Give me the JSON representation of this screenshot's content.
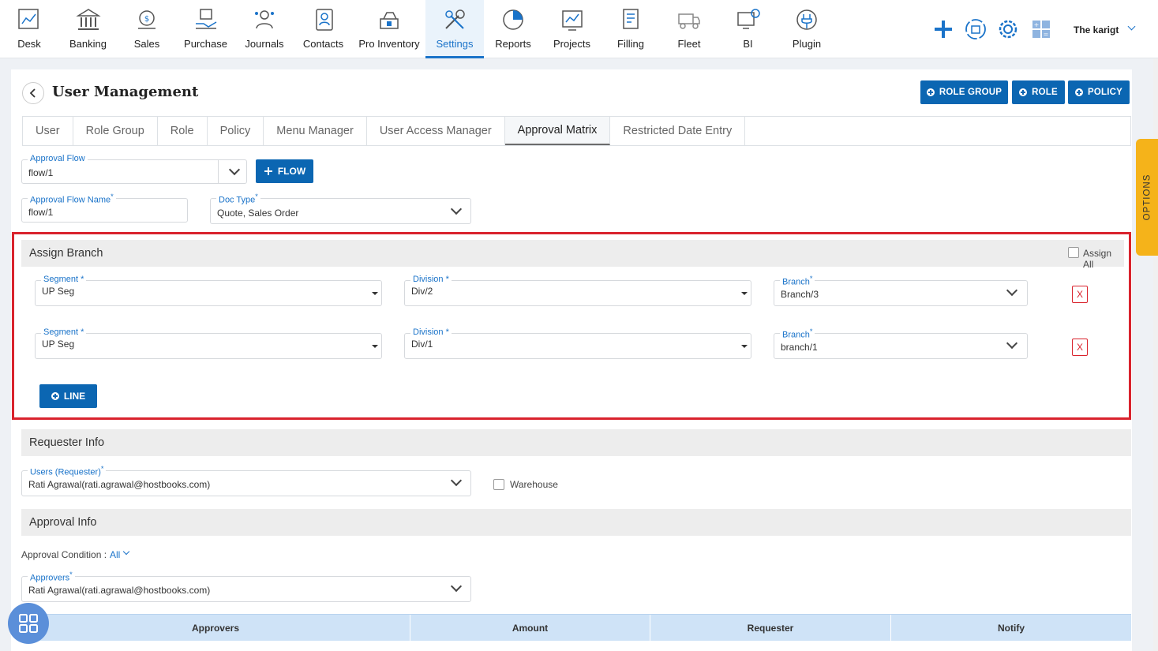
{
  "nav": {
    "items": [
      {
        "label": "Desk",
        "icon": "desk-icon"
      },
      {
        "label": "Banking",
        "icon": "bank-icon"
      },
      {
        "label": "Sales",
        "icon": "sales-icon"
      },
      {
        "label": "Purchase",
        "icon": "purchase-icon"
      },
      {
        "label": "Journals",
        "icon": "journals-icon"
      },
      {
        "label": "Contacts",
        "icon": "contacts-icon"
      },
      {
        "label": "Pro Inventory",
        "icon": "inventory-icon"
      },
      {
        "label": "Settings",
        "icon": "settings-icon"
      },
      {
        "label": "Reports",
        "icon": "reports-icon"
      },
      {
        "label": "Projects",
        "icon": "projects-icon"
      },
      {
        "label": "Filling",
        "icon": "filling-icon"
      },
      {
        "label": "Fleet",
        "icon": "fleet-icon"
      },
      {
        "label": "BI",
        "icon": "bi-icon"
      },
      {
        "label": "Plugin",
        "icon": "plugin-icon"
      }
    ],
    "active": "Settings",
    "company": "The karigt"
  },
  "page": {
    "title": "User Management",
    "buttons": {
      "role_group": "ROLE GROUP",
      "role": "ROLE",
      "policy": "POLICY"
    }
  },
  "tabs": [
    "User",
    "Role Group",
    "Role",
    "Policy",
    "Menu Manager",
    "User Access Manager",
    "Approval Matrix",
    "Restricted Date Entry"
  ],
  "active_tab": "Approval Matrix",
  "form": {
    "approval_flow": {
      "label": "Approval Flow",
      "value": "flow/1"
    },
    "flow_button": "FLOW",
    "approval_flow_name": {
      "label": "Approval Flow Name",
      "value": "flow/1"
    },
    "doc_type": {
      "label": "Doc Type",
      "value": "Quote, Sales Order"
    }
  },
  "assign_branch": {
    "title": "Assign Branch",
    "assign_all": "Assign All",
    "rows": [
      {
        "segment_label": "Segment *",
        "segment": "UP Seg",
        "division_label": "Division *",
        "division": "Div/2",
        "branch_label": "Branch",
        "branch": "Branch/3",
        "remove": "X"
      },
      {
        "segment_label": "Segment *",
        "segment": "UP Seg",
        "division_label": "Division *",
        "division": "Div/1",
        "branch_label": "Branch",
        "branch": "branch/1",
        "remove": "X"
      }
    ],
    "line_button": "LINE"
  },
  "requester": {
    "title": "Requester Info",
    "users_label": "Users (Requester)",
    "users_value": "Rati Agrawal(rati.agrawal@hostbooks.com)",
    "warehouse": "Warehouse"
  },
  "approval": {
    "title": "Approval Info",
    "condition_label": "Approval Condition :",
    "condition_value": "All",
    "approvers_label": "Approvers",
    "approvers_value": "Rati Agrawal(rati.agrawal@hostbooks.com)"
  },
  "table": {
    "headers": [
      "Approvers",
      "Amount",
      "Requester",
      "Notify"
    ]
  },
  "options_tab": "OPTIONS",
  "colors": {
    "primary": "#0b66b2",
    "highlight": "#d9232d",
    "options": "#f5b31a"
  }
}
